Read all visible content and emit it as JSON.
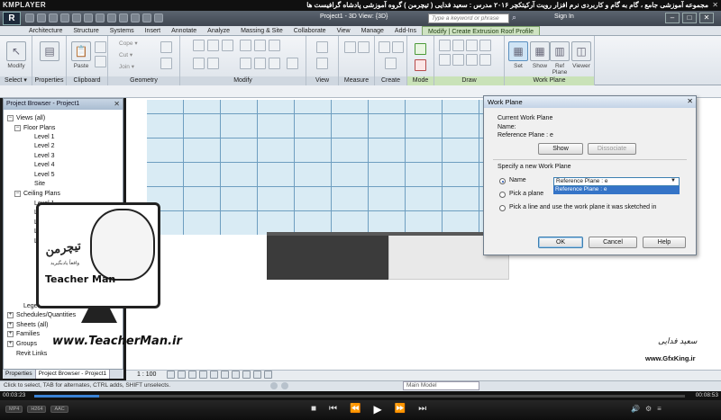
{
  "player": {
    "logo": "KMPLAYER",
    "title": "مجموعه آموزشی جامع ، گام به گام و کاربردی نرم افزار رویت آرکیتکچر ۲۰۱۶  مدرس : سعید فدایی ( تیچرمن ) گروه آموزشی پادشاه گرافیست ها",
    "close": "✕",
    "time_elapsed": "00:03:23",
    "time_total": "00:08:53",
    "progress": 0.1
  },
  "app": {
    "logo": "R",
    "doc_title": "Project1 - 3D View: {3D}",
    "search_placeholder": "Type a keyword or phrase",
    "signin": "Sign In",
    "win_min": "–",
    "win_max": "□",
    "win_close": "✕"
  },
  "ribbon_tabs": [
    {
      "label": "Architecture"
    },
    {
      "label": "Structure"
    },
    {
      "label": "Systems"
    },
    {
      "label": "Insert"
    },
    {
      "label": "Annotate"
    },
    {
      "label": "Analyze"
    },
    {
      "label": "Massing & Site"
    },
    {
      "label": "Collaborate"
    },
    {
      "label": "View"
    },
    {
      "label": "Manage"
    },
    {
      "label": "Add-Ins"
    },
    {
      "label": "Modify | Create Extrusion Roof Profile"
    }
  ],
  "ribbon_panels": {
    "select": {
      "label": "Select ▾",
      "modify": "Modify"
    },
    "properties": {
      "label": "Properties"
    },
    "clipboard": {
      "label": "Clipboard",
      "paste": "Paste"
    },
    "geometry": {
      "label": "Geometry",
      "cope": "Cope ▾",
      "cut": "Cut ▾",
      "join": "Join ▾"
    },
    "modify": {
      "label": "Modify"
    },
    "view": {
      "label": "View"
    },
    "measure": {
      "label": "Measure"
    },
    "create": {
      "label": "Create"
    },
    "mode": {
      "label": "Mode"
    },
    "draw": {
      "label": "Draw"
    },
    "work_plane": {
      "label": "Work Plane",
      "set": "Set",
      "show": "Show",
      "ref_plane": "Ref Plane",
      "viewer": "Viewer"
    }
  },
  "project_browser": {
    "title": "Project Browser - Project1",
    "close": "✕",
    "tree": [
      {
        "label": "Views (all)",
        "sign": "−"
      },
      {
        "label": "Floor Plans",
        "sign": "−"
      },
      {
        "label": "Level 1",
        "sign": ""
      },
      {
        "label": "Level 2",
        "sign": ""
      },
      {
        "label": "Level 3",
        "sign": ""
      },
      {
        "label": "Level 4",
        "sign": ""
      },
      {
        "label": "Level 5",
        "sign": ""
      },
      {
        "label": "Site",
        "sign": ""
      },
      {
        "label": "Ceiling Plans",
        "sign": "−"
      },
      {
        "label": "Level 1",
        "sign": ""
      },
      {
        "label": "Level 2",
        "sign": ""
      },
      {
        "label": "Level 3",
        "sign": ""
      },
      {
        "label": "Level 4",
        "sign": ""
      },
      {
        "label": "Level 5",
        "sign": ""
      },
      {
        "label": "Legends",
        "sign": ""
      },
      {
        "label": "Schedules/Quantities",
        "sign": "+"
      },
      {
        "label": "Sheets (all)",
        "sign": "+"
      },
      {
        "label": "Families",
        "sign": "+"
      },
      {
        "label": "Groups",
        "sign": "+"
      },
      {
        "label": "Revit Links",
        "sign": ""
      }
    ],
    "tabs": [
      {
        "label": "Properties"
      },
      {
        "label": "Project Browser - Project1"
      }
    ]
  },
  "view_bar": {
    "scale": "1 : 100"
  },
  "status_bar": {
    "hint": "Click to select, TAB for alternates, CTRL adds, SHIFT unselects.",
    "model": "Main Model"
  },
  "dialog": {
    "title": "Work Plane",
    "close": "✕",
    "current_heading": "Current Work Plane",
    "name_line": "Name:",
    "current_value": "Reference Plane : e",
    "show_btn": "Show",
    "dissociate_btn": "Dissociate",
    "specify_heading": "Specify a new Work Plane",
    "opt_name": "Name",
    "opt_pick_plane": "Pick a plane",
    "opt_pick_line": "Pick a line and use the work plane it was sketched in",
    "name_select_value": "Reference Plane : e",
    "name_dropdown_item": "Reference Plane : e",
    "ok": "OK",
    "cancel": "Cancel",
    "help": "Help"
  },
  "watermark": {
    "logo": "تیچرمن",
    "sub": "وافعاً یادبگیرید",
    "name": "Teacher Man",
    "url": "www.TeacherMan.ir",
    "sign": "سعید فدایی",
    "gk_url": "www.GfxKing.ir"
  },
  "player_controls": {
    "prev": "⏮",
    "rew": "⏪",
    "play": "▶",
    "fwd": "⏩",
    "next": "⏭",
    "stop": "■",
    "left_pills": [
      "MP4",
      "H264",
      "AAC"
    ],
    "right_btns": [
      "🔊",
      "⚙",
      "≡"
    ]
  }
}
